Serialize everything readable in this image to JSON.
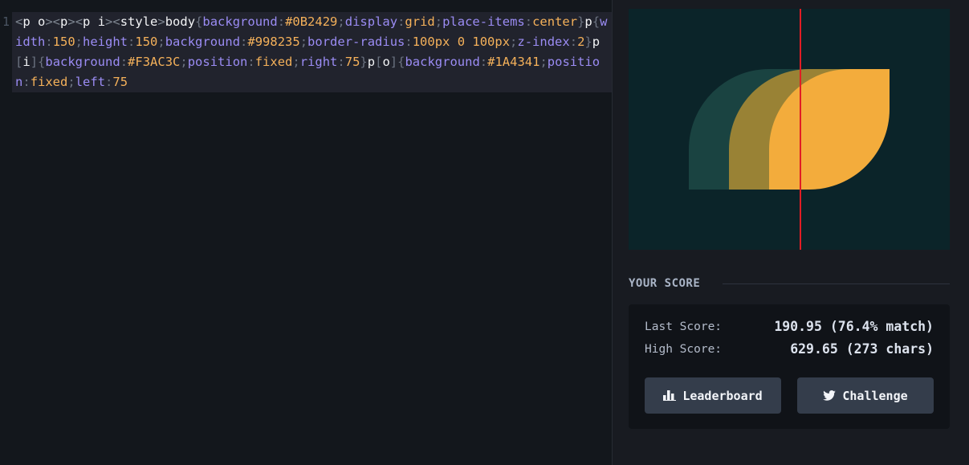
{
  "editor": {
    "line_number": "1",
    "code": [
      {
        "c": "g",
        "t": "<"
      },
      {
        "c": "t",
        "t": "p o"
      },
      {
        "c": "g",
        "t": "><"
      },
      {
        "c": "t",
        "t": "p"
      },
      {
        "c": "g",
        "t": "><"
      },
      {
        "c": "t",
        "t": "p i"
      },
      {
        "c": "g",
        "t": "><"
      },
      {
        "c": "t",
        "t": "style"
      },
      {
        "c": "g",
        "t": ">"
      },
      {
        "c": "t",
        "t": "body"
      },
      {
        "c": "p",
        "t": "{"
      },
      {
        "c": "a",
        "t": "background"
      },
      {
        "c": "p",
        "t": ":"
      },
      {
        "c": "v",
        "t": "#0B2429"
      },
      {
        "c": "p",
        "t": ";"
      },
      {
        "c": "a",
        "t": "display"
      },
      {
        "c": "p",
        "t": ":"
      },
      {
        "c": "v",
        "t": "grid"
      },
      {
        "c": "p",
        "t": ";"
      },
      {
        "c": "a",
        "t": "place-items"
      },
      {
        "c": "p",
        "t": ":"
      },
      {
        "c": "v",
        "t": "center"
      },
      {
        "c": "p",
        "t": "}"
      },
      {
        "c": "t",
        "t": "p"
      },
      {
        "c": "p",
        "t": "{"
      },
      {
        "c": "a",
        "t": "width"
      },
      {
        "c": "p",
        "t": ":"
      },
      {
        "c": "v",
        "t": "150"
      },
      {
        "c": "p",
        "t": ";"
      },
      {
        "c": "a",
        "t": "height"
      },
      {
        "c": "p",
        "t": ":"
      },
      {
        "c": "v",
        "t": "150"
      },
      {
        "c": "p",
        "t": ";"
      },
      {
        "c": "a",
        "t": "background"
      },
      {
        "c": "p",
        "t": ":"
      },
      {
        "c": "v",
        "t": "#998235"
      },
      {
        "c": "p",
        "t": ";"
      },
      {
        "c": "a",
        "t": "border-radius"
      },
      {
        "c": "p",
        "t": ":"
      },
      {
        "c": "v",
        "t": "100px 0 100px"
      },
      {
        "c": "p",
        "t": ";"
      },
      {
        "c": "a",
        "t": "z-index"
      },
      {
        "c": "p",
        "t": ":"
      },
      {
        "c": "v",
        "t": "2"
      },
      {
        "c": "p",
        "t": "}"
      },
      {
        "c": "t",
        "t": "p"
      },
      {
        "c": "p",
        "t": "["
      },
      {
        "c": "t",
        "t": "i"
      },
      {
        "c": "p",
        "t": "]{"
      },
      {
        "c": "a",
        "t": "background"
      },
      {
        "c": "p",
        "t": ":"
      },
      {
        "c": "v",
        "t": "#F3AC3C"
      },
      {
        "c": "p",
        "t": ";"
      },
      {
        "c": "a",
        "t": "position"
      },
      {
        "c": "p",
        "t": ":"
      },
      {
        "c": "v",
        "t": "fixed"
      },
      {
        "c": "p",
        "t": ";"
      },
      {
        "c": "a",
        "t": "right"
      },
      {
        "c": "p",
        "t": ":"
      },
      {
        "c": "v",
        "t": "75"
      },
      {
        "c": "p",
        "t": "}"
      },
      {
        "c": "t",
        "t": "p"
      },
      {
        "c": "p",
        "t": "["
      },
      {
        "c": "t",
        "t": "o"
      },
      {
        "c": "p",
        "t": "]{"
      },
      {
        "c": "a",
        "t": "background"
      },
      {
        "c": "p",
        "t": ":"
      },
      {
        "c": "v",
        "t": "#1A4341"
      },
      {
        "c": "p",
        "t": ";"
      },
      {
        "c": "a",
        "t": "position"
      },
      {
        "c": "p",
        "t": ":"
      },
      {
        "c": "v",
        "t": "fixed"
      },
      {
        "c": "p",
        "t": ";"
      },
      {
        "c": "a",
        "t": "left"
      },
      {
        "c": "p",
        "t": ":"
      },
      {
        "c": "v",
        "t": "75"
      }
    ]
  },
  "preview": {
    "background": "#0B2429",
    "colors": {
      "o": "#1A4341",
      "p": "#998235",
      "i": "#F3AC3C",
      "slider": "#E11D24"
    }
  },
  "score": {
    "section_title": "YOUR SCORE",
    "last_label": "Last Score:",
    "last_value": "190.95 (76.4% match)",
    "high_label": "High Score:",
    "high_value": "629.65 (273 chars)",
    "leaderboard_label": "Leaderboard",
    "leaderboard_icon": "bar-chart-icon",
    "challenge_label": "Challenge",
    "challenge_icon": "twitter-icon"
  }
}
